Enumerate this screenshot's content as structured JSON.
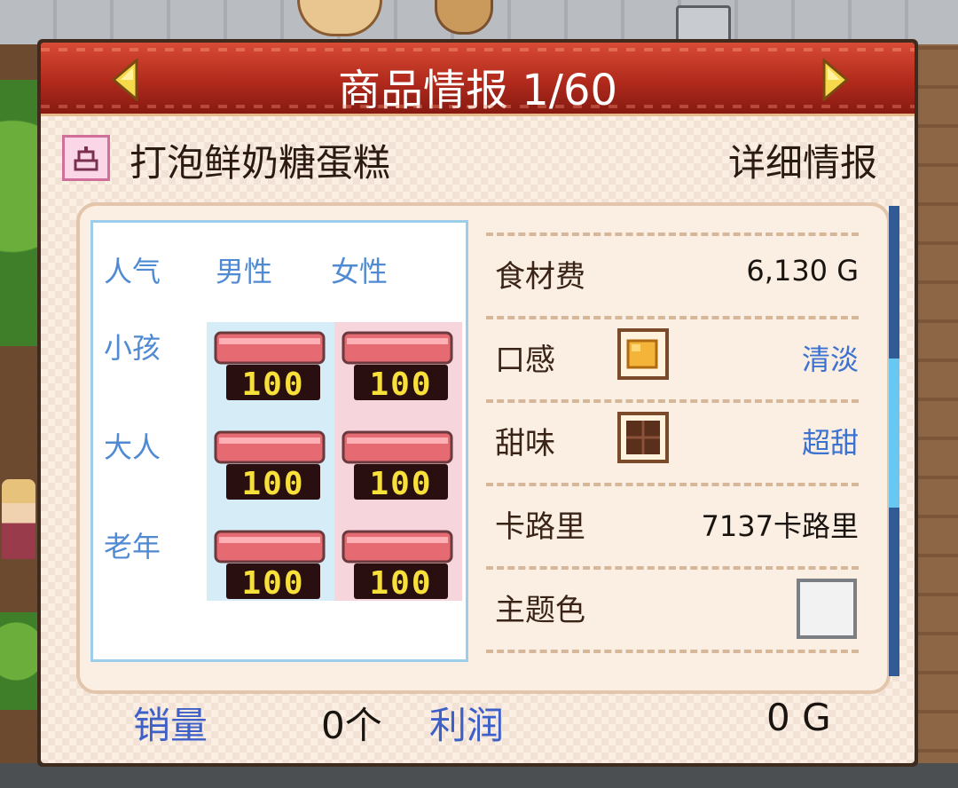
{
  "header": {
    "title": "商品情报 1/60",
    "prev_icon": "arrow-left-icon",
    "next_icon": "arrow-right-icon"
  },
  "product": {
    "icon": "cake-icon",
    "name": "打泡鲜奶糖蛋糕",
    "detail_label": "详细情报"
  },
  "popularity": {
    "header_label": "人气",
    "columns": [
      "男性",
      "女性"
    ],
    "rows": [
      {
        "label": "小孩",
        "male": 100,
        "female": 100
      },
      {
        "label": "大人",
        "male": 100,
        "female": 100
      },
      {
        "label": "老年",
        "male": 100,
        "female": 100
      }
    ],
    "male_color": "#d6ecf7",
    "female_color": "#f6d6dc"
  },
  "stats": {
    "ingredient_cost": {
      "label": "食材费",
      "value": "6,130 G"
    },
    "texture": {
      "label": "口感",
      "value": "清淡",
      "icon": "sponge-block-icon"
    },
    "sweetness": {
      "label": "甜味",
      "value": "超甜",
      "icon": "chocolate-block-icon"
    },
    "calories": {
      "label": "卡路里",
      "value": "7137卡路里"
    },
    "theme_color": {
      "label": "主题色",
      "value": "#f2f2f2"
    }
  },
  "footer": {
    "sales_label": "销量",
    "sales_value": "0个",
    "profit_label": "利润",
    "profit_value": "0 G"
  },
  "colors": {
    "header_red": "#b12a1c",
    "accent_blue": "#3d72d0",
    "panel_bg": "#fbeee2"
  }
}
